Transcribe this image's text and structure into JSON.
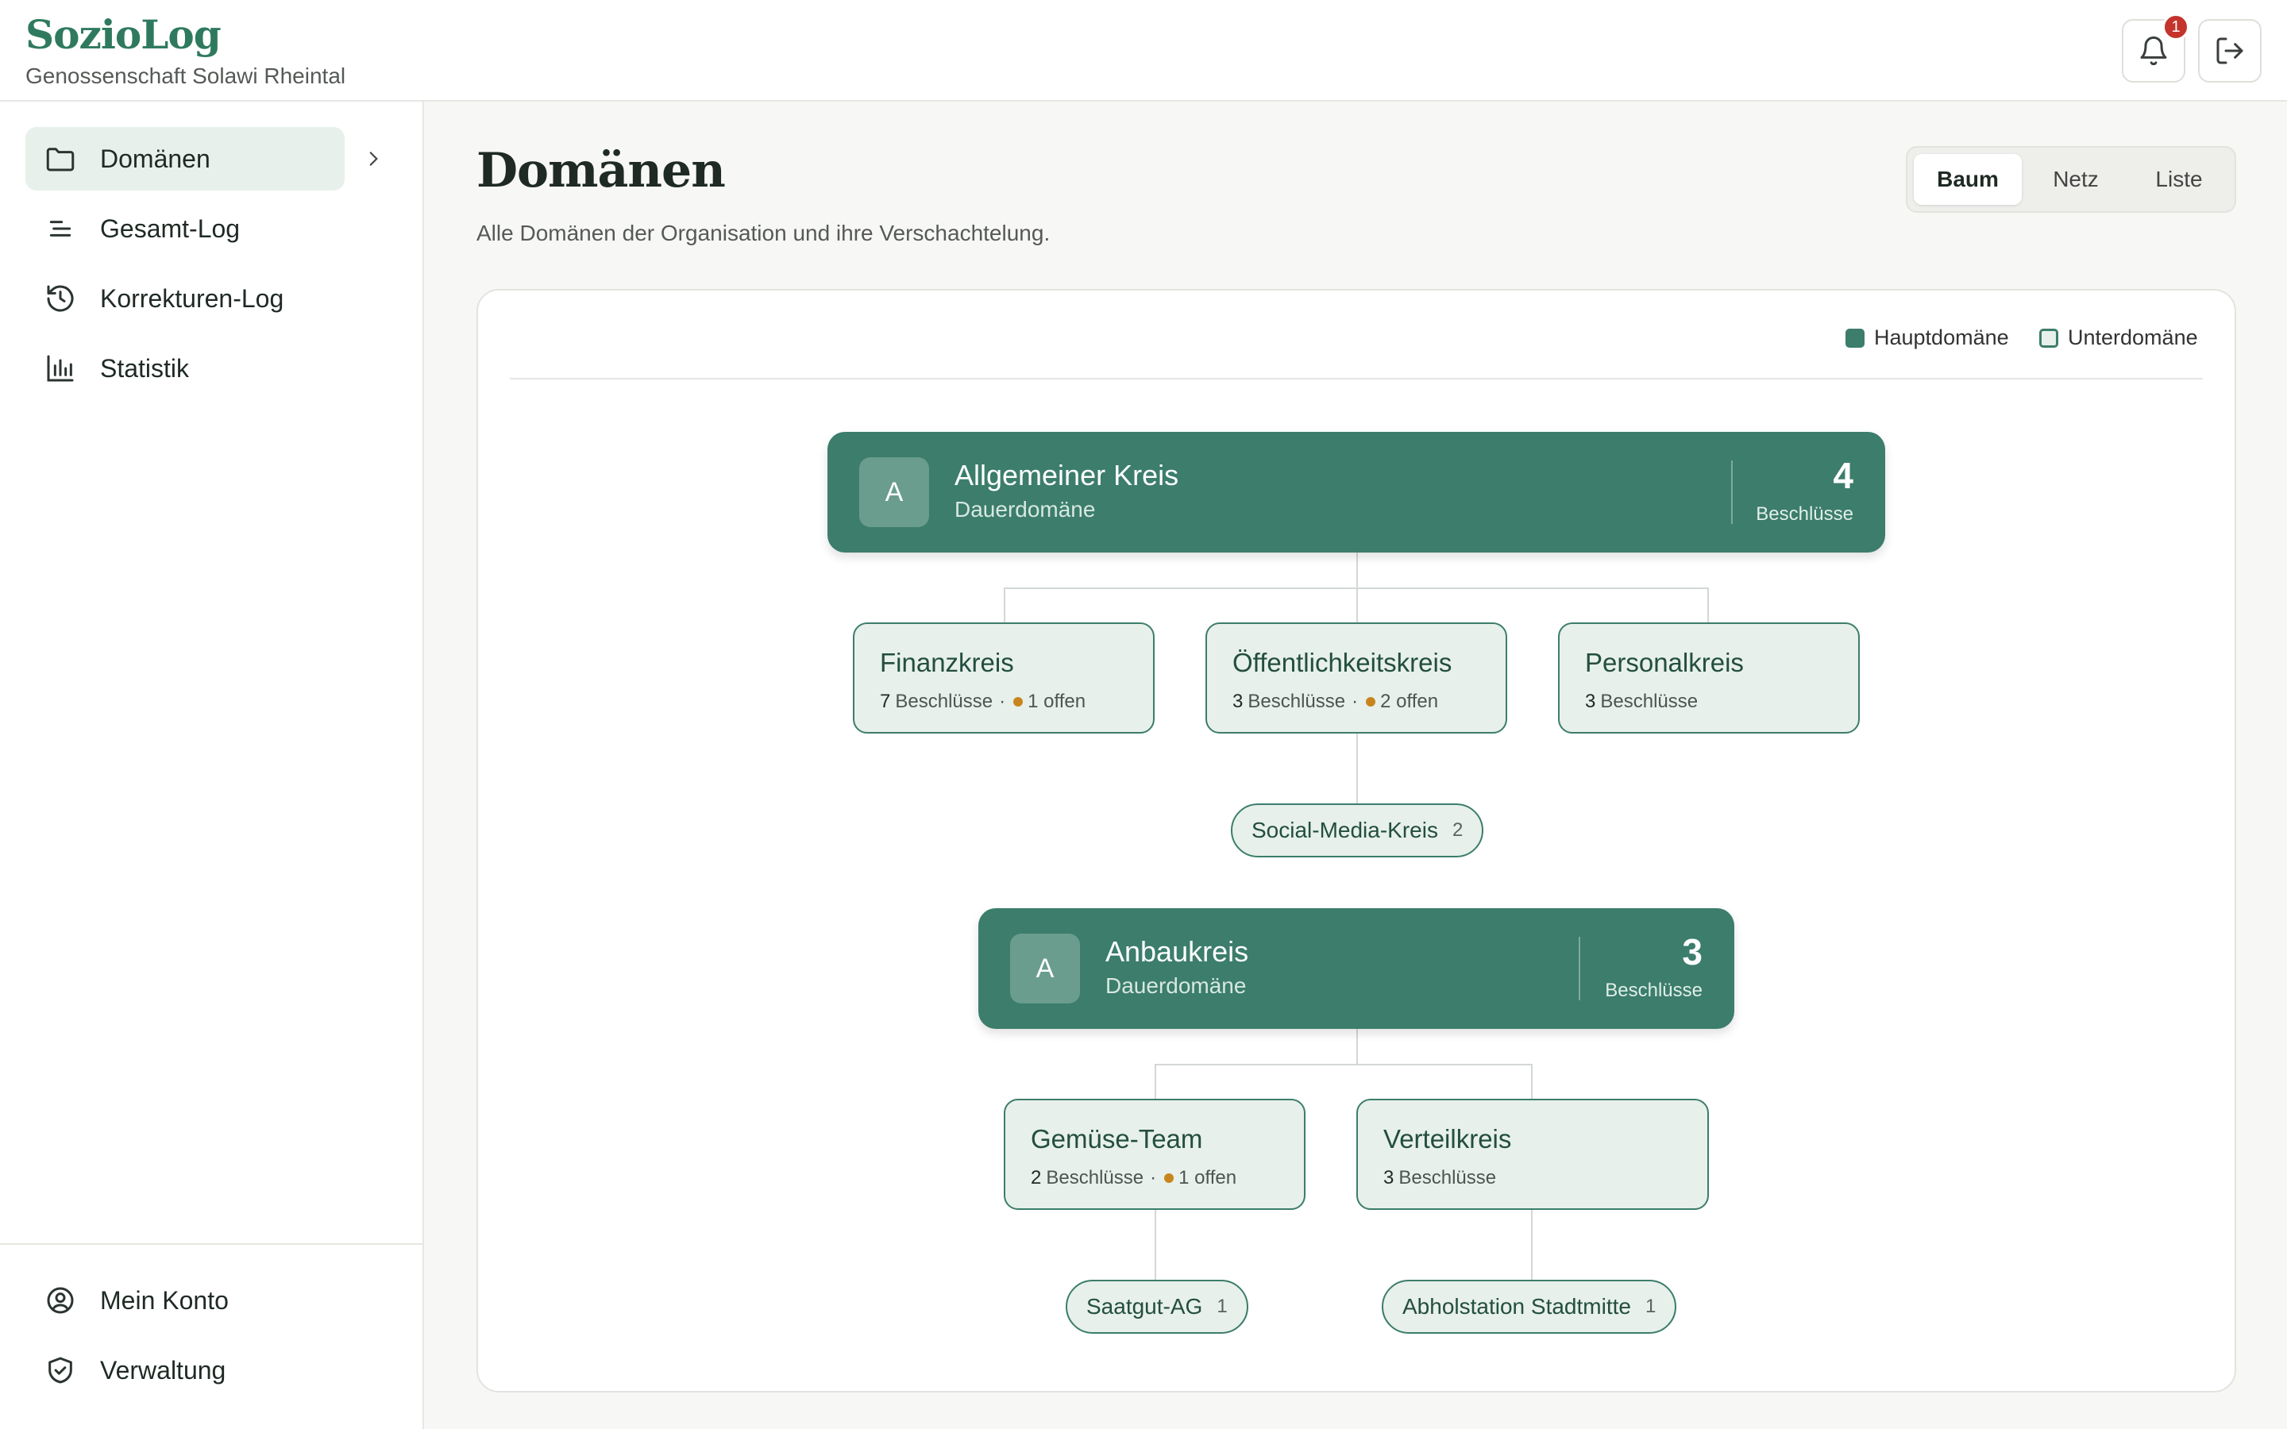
{
  "app": {
    "name": "SozioLog",
    "organization": "Genossenschaft Solawi Rheintal",
    "notifications": "1"
  },
  "sidebar": {
    "items": [
      {
        "label": "Domänen",
        "icon": "folder-icon",
        "active": true
      },
      {
        "label": "Gesamt-Log",
        "icon": "list-lines-icon"
      },
      {
        "label": "Korrekturen-Log",
        "icon": "history-icon"
      },
      {
        "label": "Statistik",
        "icon": "bar-chart-icon"
      }
    ],
    "bottom": [
      {
        "label": "Mein Konto",
        "icon": "user-circle-icon"
      },
      {
        "label": "Verwaltung",
        "icon": "shield-check-icon"
      }
    ]
  },
  "main": {
    "title": "Domänen",
    "subtitle": "Alle Domänen der Organisation und ihre Verschachtelung.",
    "views": [
      "Baum",
      "Netz",
      "Liste"
    ],
    "active_view": "Baum"
  },
  "legend": {
    "main": "Hauptdomäne",
    "sub": "Unterdomäne"
  },
  "tree": {
    "allgemein": {
      "avatar": "A",
      "name": "Allgemeiner Kreis",
      "type": "Dauerdomäne",
      "count": "4",
      "count_label": "Beschlüsse",
      "children": [
        {
          "name": "Finanzkreis",
          "count": "7",
          "count_label": "Beschlüsse",
          "sep": "·",
          "open": "1 offen"
        },
        {
          "name": "Öffentlichkeitskreis",
          "count": "3",
          "count_label": "Beschlüsse",
          "sep": "·",
          "open": "2 offen"
        },
        {
          "name": "Personalkreis",
          "count": "3",
          "count_label": "Beschlüsse"
        }
      ],
      "pills": [
        {
          "name": "Social-Media-Kreis",
          "count": "2"
        }
      ]
    },
    "anbau": {
      "avatar": "A",
      "name": "Anbaukreis",
      "type": "Dauerdomäne",
      "count": "3",
      "count_label": "Beschlüsse",
      "children": [
        {
          "name": "Gemüse-Team",
          "count": "2",
          "count_label": "Beschlüsse",
          "sep": "·",
          "open": "1 offen"
        },
        {
          "name": "Verteilkreis",
          "count": "3",
          "count_label": "Beschlüsse"
        }
      ],
      "pills": [
        {
          "name": "Saatgut-AG",
          "count": "1"
        },
        {
          "name": "Abholstation Stadtmitte",
          "count": "1"
        }
      ]
    }
  },
  "colors": {
    "brand": "#2f7a5e",
    "main_domain": "#3c7d6b",
    "sub_domain_bg": "#e7f0ea",
    "open_dot": "#c8851d",
    "badge": "#c4332c"
  }
}
